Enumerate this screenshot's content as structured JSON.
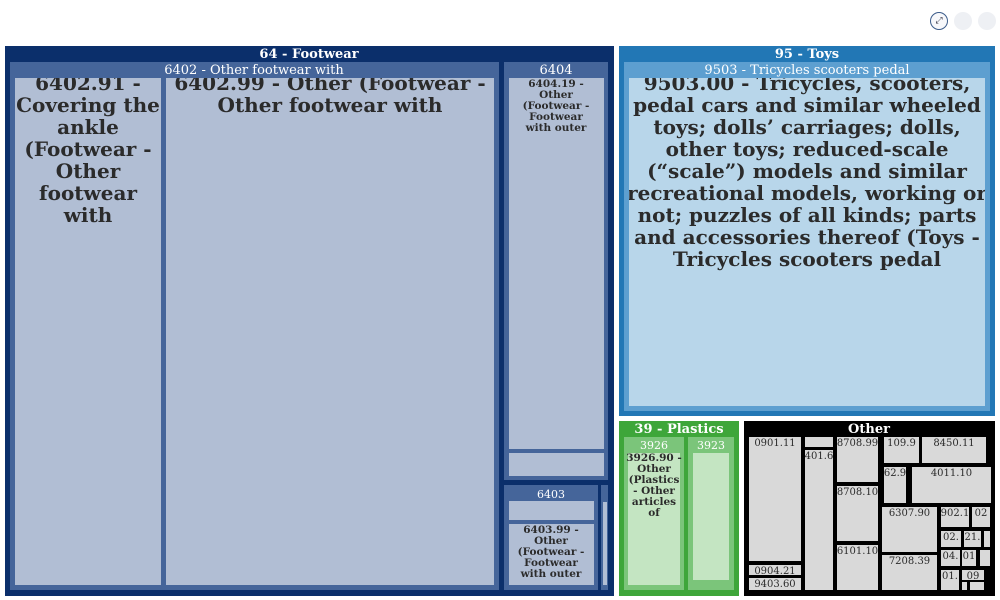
{
  "toolbar": {
    "buttons": [
      "expand-icon",
      "zoom-icon",
      "reset-icon"
    ]
  },
  "colors": {
    "footwear_dark": "#0b2f6b",
    "footwear_mid": "#45659a",
    "footwear_leaf": "#b1bed4",
    "toys_dark": "#2277b5",
    "toys_mid": "#5d9fd0",
    "toys_leaf": "#b8d6ea",
    "plastics_dark": "#3ea63a",
    "plastics_mid": "#7bc57a",
    "plastics_leaf": "#c4e5c2",
    "other_dark": "#000000",
    "other_leaf": "#d9d9d9"
  },
  "chart_data": {
    "type": "treemap",
    "groups": [
      {
        "id": "footwear",
        "label": "64 - Footwear",
        "share": 0.46,
        "children": [
          {
            "id": "6402",
            "label": "6402 - Other footwear with",
            "leaves": [
              {
                "code": "6402.91",
                "label": "6402.91 - Covering the ankle (Footwear - Other footwear with"
              },
              {
                "code": "6402.99",
                "label": "6402.99 - Other (Footwear - Other footwear with"
              }
            ]
          },
          {
            "id": "6404",
            "label": "6404",
            "leaves": [
              {
                "code": "6404.19",
                "label": "6404.19 - Other (Footwear - Footwear with outer"
              }
            ]
          },
          {
            "id": "6403",
            "label": "6403",
            "leaves": [
              {
                "code": "6403.99",
                "label": "6403.99 - Other (Footwear - Footwear with outer"
              }
            ]
          }
        ]
      },
      {
        "id": "toys",
        "label": "95 - Toys",
        "share": 0.29,
        "children": [
          {
            "id": "9503",
            "label": "9503 - Tricycles scooters pedal",
            "leaves": [
              {
                "code": "9503.00",
                "label": "9503.00 - Tricycles, scooters, pedal cars and similar wheeled toys; dolls’ carriages; dolls, other toys; reduced-scale (“scale”) models and similar recreational models, working or not; puzzles of all kinds; parts and accessories thereof (Toys - Tricycles scooters pedal"
              }
            ]
          }
        ]
      },
      {
        "id": "plastics",
        "label": "39 - Plastics",
        "share": 0.06,
        "children": [
          {
            "id": "3926",
            "label": "3926",
            "leaves": [
              {
                "code": "3926.90",
                "label": "3926.90 - Other (Plastics - Other articles of"
              }
            ]
          },
          {
            "id": "3923",
            "label": "3923",
            "leaves": []
          }
        ]
      },
      {
        "id": "other",
        "label": "Other",
        "share": 0.19,
        "leaves": [
          "0901.11",
          "0904.21",
          "9403.60",
          "401.6",
          "8708.99",
          "8708.10",
          "6101.10",
          "109.9",
          "8450.11",
          "62.9",
          "4011.10",
          "6307.90",
          "902.1",
          "02",
          "7208.39",
          "02.",
          "21.",
          "04.",
          "01",
          "09",
          "01."
        ]
      }
    ]
  }
}
